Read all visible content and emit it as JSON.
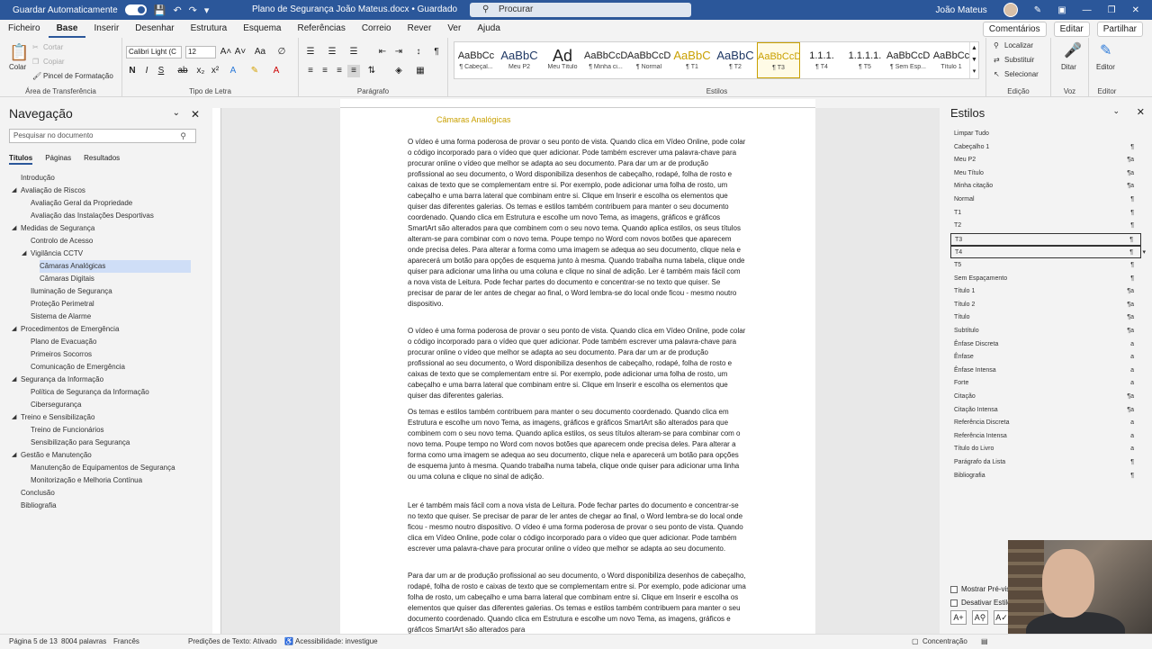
{
  "titlebar": {
    "autosave_label": "Guardar Automaticamente",
    "document_title": "Plano de Segurança João Mateus.docx • Guardado",
    "search_placeholder": "Procurar",
    "user_name": "João Mateus"
  },
  "tabs": [
    "Ficheiro",
    "Base",
    "Inserir",
    "Desenhar",
    "Estrutura",
    "Esquema",
    "Referências",
    "Correio",
    "Rever",
    "Ver",
    "Ajuda"
  ],
  "active_tab": "Base",
  "tabs_right": {
    "comments": "Comentários",
    "editing": "Editar",
    "share": "Partilhar"
  },
  "ribbon": {
    "clipboard": {
      "label": "Área de Transferência",
      "paste": "Colar",
      "cut": "Cortar",
      "copy": "Copiar",
      "format_painter": "Pincel de Formatação"
    },
    "font": {
      "label": "Tipo de Letra",
      "family": "Calibri Light (C",
      "size": "12"
    },
    "paragraph": {
      "label": "Parágrafo"
    },
    "styles": {
      "label": "Estilos",
      "items": [
        {
          "preview": "AaBbCc",
          "name": "¶ Cabeçal..."
        },
        {
          "preview": "AaBbC",
          "name": "Meu P2"
        },
        {
          "preview": "Ad",
          "name": "Meu Título"
        },
        {
          "preview": "AaBbCcDc",
          "name": "¶ Minha ci..."
        },
        {
          "preview": "AaBbCcDc",
          "name": "¶ Normal"
        },
        {
          "preview": "AaBbC",
          "name": "¶ T1"
        },
        {
          "preview": "AaBbC",
          "name": "¶ T2"
        },
        {
          "preview": "AaBbCcD",
          "name": "¶ T3"
        },
        {
          "preview": "1.1.1.",
          "name": "¶ T4"
        },
        {
          "preview": "1.1.1.1.",
          "name": "¶ T5"
        },
        {
          "preview": "AaBbCcDc",
          "name": "¶ Sem Esp..."
        },
        {
          "preview": "AaBbCc",
          "name": "Título 1"
        }
      ]
    },
    "editing": {
      "label": "Edição",
      "find": "Localizar",
      "replace": "Substituir",
      "select": "Selecionar"
    },
    "voice": {
      "label": "Voz",
      "dictate": "Ditar"
    },
    "editor": {
      "label": "Editor",
      "editor": "Editor"
    }
  },
  "navigation": {
    "title": "Navegação",
    "search_placeholder": "Pesquisar no documento",
    "tabs": [
      "Títulos",
      "Páginas",
      "Resultados"
    ],
    "items": [
      {
        "label": "Introdução",
        "level": 1
      },
      {
        "label": "Avaliação de Riscos",
        "level": 1,
        "expanded": true
      },
      {
        "label": "Avaliação Geral da Propriedade",
        "level": 2
      },
      {
        "label": "Avaliação das Instalações Desportivas",
        "level": 2
      },
      {
        "label": "Medidas de Segurança",
        "level": 1,
        "expanded": true
      },
      {
        "label": "Controlo de Acesso",
        "level": 2
      },
      {
        "label": "Vigilância CCTV",
        "level": 2,
        "expanded": true
      },
      {
        "label": "Câmaras Analógicas",
        "level": 3,
        "selected": true
      },
      {
        "label": "Câmaras Digitais",
        "level": 3
      },
      {
        "label": "Iluminação de Segurança",
        "level": 2
      },
      {
        "label": "Proteção Perimetral",
        "level": 2
      },
      {
        "label": "Sistema de Alarme",
        "level": 2
      },
      {
        "label": "Procedimentos de Emergência",
        "level": 1,
        "expanded": true
      },
      {
        "label": "Plano de Evacuação",
        "level": 2
      },
      {
        "label": "Primeiros Socorros",
        "level": 2
      },
      {
        "label": "Comunicação de Emergência",
        "level": 2
      },
      {
        "label": "Segurança da Informação",
        "level": 1,
        "expanded": true
      },
      {
        "label": "Política de Segurança da Informação",
        "level": 2
      },
      {
        "label": "Cibersegurança",
        "level": 2
      },
      {
        "label": "Treino e Sensibilização",
        "level": 1,
        "expanded": true
      },
      {
        "label": "Treino de Funcionários",
        "level": 2
      },
      {
        "label": "Sensibilização para Segurança",
        "level": 2
      },
      {
        "label": "Gestão e Manutenção",
        "level": 1,
        "expanded": true
      },
      {
        "label": "Manutenção de Equipamentos de Segurança",
        "level": 2
      },
      {
        "label": "Monitorização e Melhoria Contínua",
        "level": 2
      },
      {
        "label": "Conclusão",
        "level": 1
      },
      {
        "label": "Bibliografia",
        "level": 1
      }
    ]
  },
  "document": {
    "heading": "Câmaras Analógicas",
    "paragraphs": [
      "O vídeo é uma forma poderosa de provar o seu ponto de vista. Quando clica em Vídeo Online, pode colar o código incorporado para o vídeo que quer adicionar. Pode também escrever uma palavra-chave para procurar online o vídeo que melhor se adapta ao seu documento. Para dar um ar de produção profissional ao seu documento, o Word disponibiliza desenhos de cabeçalho, rodapé, folha de rosto e caixas de texto que se complementam entre si. Por exemplo, pode adicionar uma folha de rosto, um cabeçalho e uma barra lateral que combinam entre si. Clique em Inserir e escolha os elementos que quiser das diferentes galerias. Os temas e estilos também contribuem para manter o seu documento coordenado. Quando clica em Estrutura e escolhe um novo Tema, as imagens, gráficos e gráficos SmartArt são alterados para que combinem com o seu novo tema. Quando aplica estilos, os seus títulos alteram-se para combinar com o novo tema. Poupe tempo no Word com novos botões que aparecem onde precisa deles. Para alterar a forma como uma imagem se adequa ao seu documento, clique nela e aparecerá um botão para opções de esquema junto à mesma. Quando trabalha numa tabela, clique onde quiser para adicionar uma linha ou uma coluna e  clique no sinal de adição. Ler é também mais fácil com a nova vista de Leitura. Pode fechar partes do documento e concentrar-se no texto que quiser. Se precisar de parar de ler antes de chegar ao final, o Word lembra-se do local onde ficou - mesmo noutro dispositivo.",
      "O vídeo é uma forma poderosa de provar o seu ponto de vista. Quando clica em Vídeo Online, pode colar o código incorporado para o vídeo que quer adicionar. Pode também escrever uma palavra-chave para procurar online o vídeo que melhor se adapta ao seu documento. Para dar um ar de produção profissional ao seu documento, o Word disponibiliza desenhos de cabeçalho, rodapé, folha de rosto e caixas de texto que se complementam entre si. Por exemplo, pode adicionar uma folha de rosto, um cabeçalho e uma barra lateral que combinam entre si. Clique em Inserir e escolha os elementos que quiser das diferentes galerias.",
      "Os temas e estilos também contribuem para manter o seu documento coordenado. Quando clica em Estrutura e escolhe um novo Tema, as imagens, gráficos e gráficos SmartArt são alterados para que combinem com o seu novo tema. Quando aplica estilos, os seus títulos alteram-se para combinar com o novo tema. Poupe tempo no Word com novos botões que aparecem onde precisa deles. Para alterar a forma como uma imagem se adequa ao seu documento, clique nela e aparecerá um botão para opções de esquema junto à mesma. Quando trabalha numa tabela, clique onde quiser para adicionar uma linha ou uma coluna e clique no sinal de adição.",
      "Ler é também mais fácil com a nova vista de Leitura. Pode fechar partes do documento e concentrar-se no texto que quiser. Se precisar de parar de ler antes de chegar ao final, o Word lembra-se do local onde ficou - mesmo noutro dispositivo. O vídeo é uma forma poderosa de provar o seu ponto de vista. Quando clica em Vídeo Online, pode colar o código incorporado para o vídeo que quer adicionar. Pode também escrever uma palavra-chave para procurar online o vídeo que melhor se adapta ao seu documento.",
      "Para dar um ar de produção profissional ao seu documento, o Word disponibiliza desenhos de cabeçalho, rodapé, folha de rosto e caixas de texto que se complementam entre si. Por exemplo, pode adicionar uma folha de rosto, um cabeçalho e uma barra lateral que combinam entre si. Clique em Inserir e escolha os elementos que quiser das diferentes galerias. Os temas e estilos também contribuem para manter o seu documento coordenado. Quando clica em Estrutura e escolhe um novo Tema, as imagens, gráficos e gráficos SmartArt são alterados para"
    ]
  },
  "styles_pane": {
    "title": "Estilos",
    "items": [
      {
        "label": "Limpar Tudo",
        "icon": ""
      },
      {
        "label": "Cabeçalho 1",
        "icon": "¶"
      },
      {
        "label": "Meu P2",
        "icon": "¶a"
      },
      {
        "label": "Meu Título",
        "icon": "¶a"
      },
      {
        "label": "Minha citação",
        "icon": "¶a"
      },
      {
        "label": "Normal",
        "icon": "¶"
      },
      {
        "label": "T1",
        "icon": "¶"
      },
      {
        "label": "T2",
        "icon": "¶"
      },
      {
        "label": "T3",
        "icon": "¶",
        "selected": true
      },
      {
        "label": "T4",
        "icon": "¶",
        "selected": true,
        "dropdown": true
      },
      {
        "label": "T5",
        "icon": "¶"
      },
      {
        "label": "Sem Espaçamento",
        "icon": "¶"
      },
      {
        "label": "Título 1",
        "icon": "¶a"
      },
      {
        "label": "Título 2",
        "icon": "¶a"
      },
      {
        "label": "Título",
        "icon": "¶a"
      },
      {
        "label": "Subtítulo",
        "icon": "¶a"
      },
      {
        "label": "Ênfase Discreta",
        "icon": "a"
      },
      {
        "label": "Ênfase",
        "icon": "a"
      },
      {
        "label": "Ênfase Intensa",
        "icon": "a"
      },
      {
        "label": "Forte",
        "icon": "a"
      },
      {
        "label": "Citação",
        "icon": "¶a"
      },
      {
        "label": "Citação Intensa",
        "icon": "¶a"
      },
      {
        "label": "Referência Discreta",
        "icon": "a"
      },
      {
        "label": "Referência Intensa",
        "icon": "a"
      },
      {
        "label": "Título do Livro",
        "icon": "a"
      },
      {
        "label": "Parágrafo da Lista",
        "icon": "¶"
      },
      {
        "label": "Bibliografia",
        "icon": "¶"
      }
    ],
    "show_preview": "Mostrar Pré-vis",
    "disable_linked": "Desativar Estilo"
  },
  "statusbar": {
    "page": "Página 5 de 13",
    "words": "8004 palavras",
    "language": "Francês",
    "predictions": "Predições de Texto: Ativado",
    "accessibility": "Acessibilidade: investigue",
    "focus": "Concentração"
  }
}
